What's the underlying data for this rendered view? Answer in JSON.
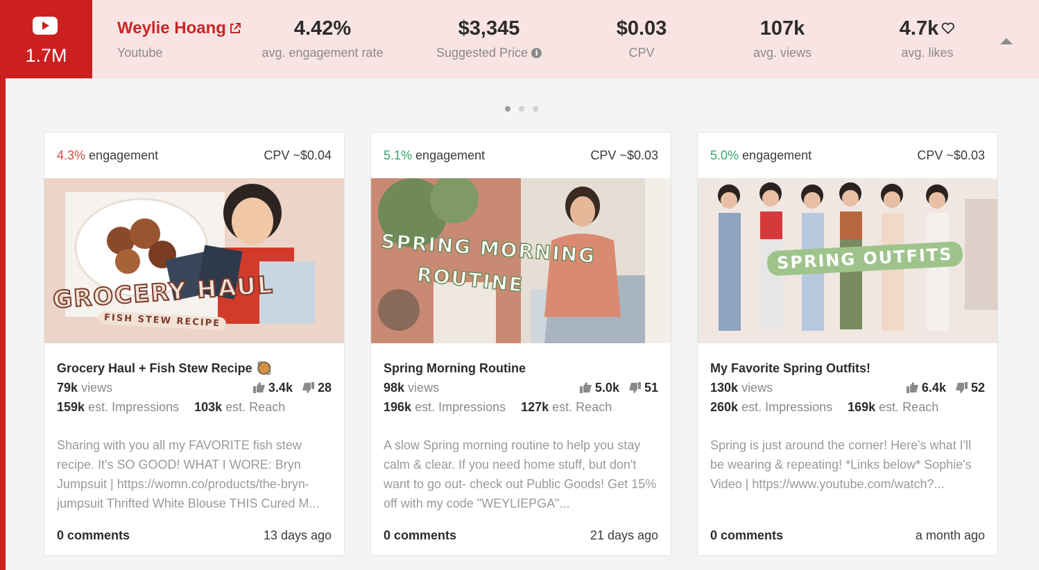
{
  "creator": {
    "subscribers": "1.7M",
    "name": "Weylie Hoang",
    "platform": "Youtube"
  },
  "stats": [
    {
      "value": "4.42%",
      "label": "avg. engagement rate"
    },
    {
      "value": "$3,345",
      "label": "Suggested Price"
    },
    {
      "value": "$0.03",
      "label": "CPV"
    },
    {
      "value": "107k",
      "label": "avg. views"
    },
    {
      "value": "4.7k",
      "label": "avg. likes"
    }
  ],
  "carousel": {
    "pages": 3,
    "active": 0
  },
  "colors": {
    "brand_red": "#cc1f1f",
    "header_bg": "#f9e4e4",
    "engagement_low": "#d04a3a",
    "engagement_high": "#3aa56b"
  },
  "cards": [
    {
      "engagement_value": "4.3%",
      "engagement_label": "engagement",
      "engagement_color": "red",
      "cpv": "CPV ~$0.04",
      "thumb_text_1": "GROCERY HAUL",
      "thumb_text_2": "FISH STEW RECIPE",
      "thumb_text_3": "",
      "title": "Grocery Haul + Fish Stew Recipe",
      "title_emoji": "🥘",
      "views": "79k",
      "views_label": "views",
      "likes": "3.4k",
      "dislikes": "28",
      "impressions": "159k",
      "impressions_label": "est. Impressions",
      "reach": "103k",
      "reach_label": "est. Reach",
      "description": "Sharing with you all my FAVORITE fish stew recipe. It's SO GOOD! WHAT I WORE: Bryn Jumpsuit | https://womn.co/products/the-bryn-jumpsuit Thrifted White Blouse THIS Cured M...",
      "comments": "0 comments",
      "age": "13 days ago"
    },
    {
      "engagement_value": "5.1%",
      "engagement_label": "engagement",
      "engagement_color": "green",
      "cpv": "CPV ~$0.03",
      "thumb_text_1": "SPRING MORNING",
      "thumb_text_2": "ROUTINE",
      "thumb_text_3": "",
      "title": "Spring Morning Routine",
      "title_emoji": "",
      "views": "98k",
      "views_label": "views",
      "likes": "5.0k",
      "dislikes": "51",
      "impressions": "196k",
      "impressions_label": "est. Impressions",
      "reach": "127k",
      "reach_label": "est. Reach",
      "description": "A slow Spring morning routine to help you stay calm & clear. If you need home stuff, but don't want to go out- check out Public Goods! Get 15% off with my code \"WEYLIEPGA\"...",
      "comments": "0 comments",
      "age": "21 days ago"
    },
    {
      "engagement_value": "5.0%",
      "engagement_label": "engagement",
      "engagement_color": "green",
      "cpv": "CPV ~$0.03",
      "thumb_text_1": "SPRING OUTFITS",
      "thumb_text_2": "",
      "thumb_text_3": "",
      "title": "My Favorite Spring Outfits!",
      "title_emoji": "",
      "views": "130k",
      "views_label": "views",
      "likes": "6.4k",
      "dislikes": "52",
      "impressions": "260k",
      "impressions_label": "est. Impressions",
      "reach": "169k",
      "reach_label": "est. Reach",
      "description": "Spring is just around the corner! Here's what I'll be wearing & repeating! *Links below* Sophie's Video | https://www.youtube.com/watch?...",
      "comments": "0 comments",
      "age": "a month ago"
    }
  ]
}
